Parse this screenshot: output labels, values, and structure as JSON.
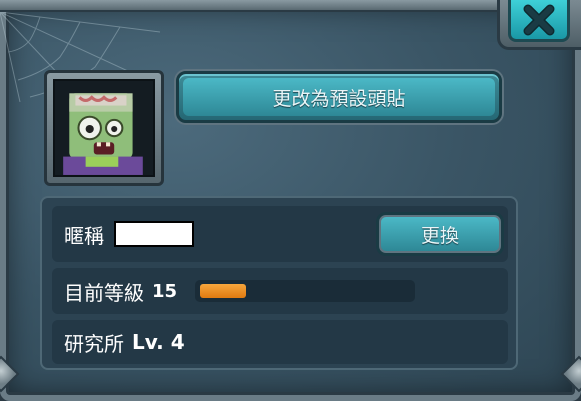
{
  "dialog": {
    "close_icon": "close-x-icon",
    "avatar_icon": "zombie-avatar-icon",
    "default_avatar_button": "更改為預設頭貼",
    "nickname_label": "暱稱",
    "nickname_value": "",
    "change_button": "更換",
    "level_label": "目前等級",
    "level_value": "15",
    "level_progress": 0.22,
    "lab_label": "研究所",
    "lab_level": "Lv. 4"
  },
  "colors": {
    "accent": "#2e9aa8",
    "xp_fill": "#f0911e",
    "panel": "#3a5565"
  }
}
